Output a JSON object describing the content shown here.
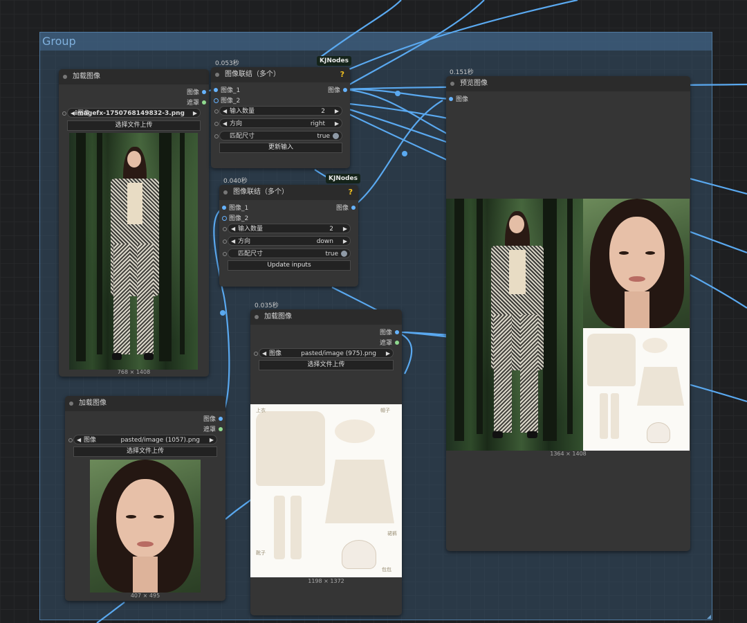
{
  "group": {
    "title": "Group"
  },
  "nodes": {
    "load1": {
      "title": "加载图像",
      "outputs": [
        "图像",
        "遮罩"
      ],
      "image_widget": {
        "label": "图像",
        "value": "imagefx-1750768149832-3.png"
      },
      "upload_label": "选择文件上传",
      "dimensions": "768 × 1408"
    },
    "concat1": {
      "exec_time": "0.053秒",
      "badge": "KJNodes",
      "title": "图像联结（多个）",
      "help": "?",
      "inputs": [
        "图像_1",
        "图像_2"
      ],
      "output": "图像",
      "widgets": [
        {
          "label": "输入数量",
          "value": "2"
        },
        {
          "label": "方向",
          "value": "right"
        },
        {
          "label": "匹配尺寸",
          "value": "true"
        }
      ],
      "button": "更新输入"
    },
    "concat2": {
      "exec_time": "0.040秒",
      "badge": "KJNodes",
      "title": "图像联结（多个）",
      "help": "?",
      "inputs": [
        "图像_1",
        "图像_2"
      ],
      "output": "图像",
      "widgets": [
        {
          "label": "输入数量",
          "value": "2"
        },
        {
          "label": "方向",
          "value": "down"
        },
        {
          "label": "匹配尺寸",
          "value": "true"
        }
      ],
      "button": "Update inputs"
    },
    "preview": {
      "exec_time": "0.151秒",
      "title": "预览图像",
      "input": "图像",
      "dimensions": "1364 × 1408"
    },
    "load2": {
      "title": "加载图像",
      "outputs": [
        "图像",
        "遮罩"
      ],
      "image_widget": {
        "label": "图像",
        "value": "pasted/image (1057).png"
      },
      "upload_label": "选择文件上传",
      "dimensions": "407 × 495"
    },
    "load3": {
      "exec_time": "0.035秒",
      "title": "加载图像",
      "outputs": [
        "图像",
        "遮罩"
      ],
      "image_widget": {
        "label": "图像",
        "value": "pasted/image (975).png"
      },
      "upload_label": "选择文件上传",
      "dimensions": "1198 × 1372",
      "outfit_labels": [
        "上衣",
        "帽子",
        "裙裤",
        "靴子",
        "包包"
      ]
    }
  },
  "colors": {
    "link": "#5aa9f0",
    "group_border": "#4f7aa1",
    "node_bg": "#353535"
  }
}
